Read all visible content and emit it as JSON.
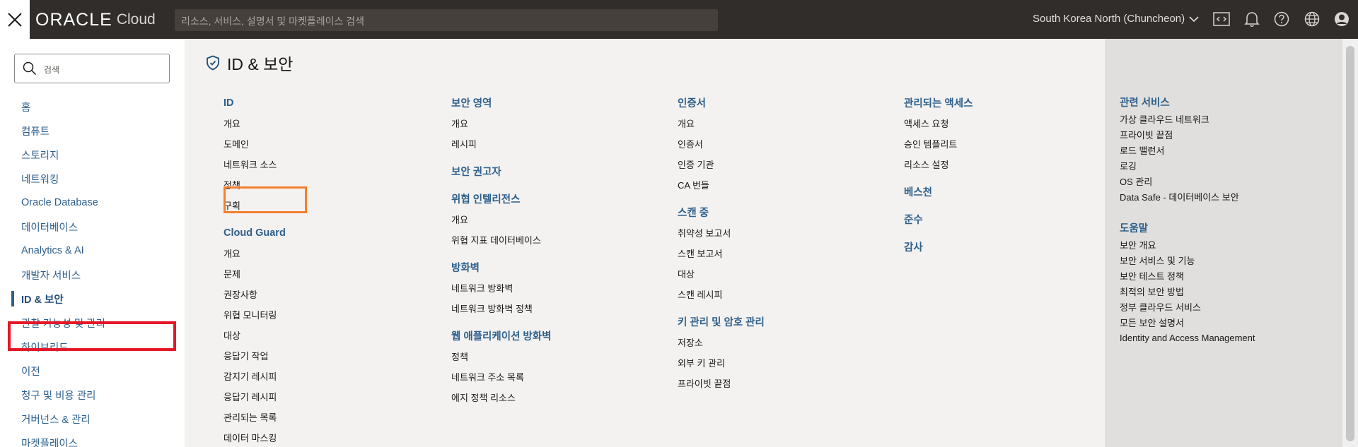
{
  "topbar": {
    "logo_oracle": "ORACLE",
    "logo_cloud": "Cloud",
    "search_placeholder": "리소스, 서비스, 설명서 및 마켓플레이스 검색",
    "region": "South Korea North (Chuncheon)",
    "icons": [
      "close-icon",
      "code-editor-icon",
      "bell-icon",
      "help-icon",
      "globe-icon",
      "profile-icon"
    ]
  },
  "sidebar": {
    "search_placeholder": "검색",
    "items": [
      {
        "label": "홈"
      },
      {
        "label": "컴퓨트"
      },
      {
        "label": "스토리지"
      },
      {
        "label": "네트워킹"
      },
      {
        "label": "Oracle Database"
      },
      {
        "label": "데이터베이스"
      },
      {
        "label": "Analytics & AI"
      },
      {
        "label": "개발자 서비스"
      },
      {
        "label": "ID & 보안",
        "active": true
      },
      {
        "label": "관찰 가능성 및 관리"
      },
      {
        "label": "하이브리드"
      },
      {
        "label": "이전"
      },
      {
        "label": "청구 및 비용 관리"
      },
      {
        "label": "거버넌스 & 관리"
      },
      {
        "label": "마켓플레이스"
      }
    ]
  },
  "main": {
    "title": "ID & 보안",
    "columns": [
      {
        "sections": [
          {
            "head": "ID",
            "links": [
              "개요",
              "도메인",
              "네트워크 소스",
              "정책",
              "구획"
            ]
          },
          {
            "head": "Cloud Guard",
            "links": [
              "개요",
              "문제",
              "권장사항",
              "위협 모니터링",
              "대상",
              "응답기 작업",
              "감지기 레시피",
              "응답기 레시피",
              "관리되는 목록",
              "데이터 마스킹"
            ]
          }
        ]
      },
      {
        "sections": [
          {
            "head": "보안 영역",
            "links": [
              "개요",
              "레시피"
            ]
          },
          {
            "head": "보안 권고자",
            "links": []
          },
          {
            "head": "위협 인텔리전스",
            "links": [
              "개요",
              "위협 지표 데이터베이스"
            ]
          },
          {
            "head": "방화벽",
            "links": [
              "네트워크 방화벽",
              "네트워크 방화벽 정책"
            ]
          },
          {
            "head": "웹 애플리케이션 방화벽",
            "links": [
              "정책",
              "네트워크 주소 목록",
              "에지 정책 리소스"
            ]
          }
        ]
      },
      {
        "sections": [
          {
            "head": "인증서",
            "links": [
              "개요",
              "인증서",
              "인증 기관",
              "CA 번들"
            ]
          },
          {
            "head": "스캔 중",
            "links": [
              "취약성 보고서",
              "스캔 보고서",
              "대상",
              "스캔 레시피"
            ]
          },
          {
            "head": "키 관리 및 암호 관리",
            "links": [
              "저장소",
              "외부 키 관리",
              "프라이빗 끝점"
            ]
          }
        ]
      },
      {
        "sections": [
          {
            "head": "관리되는 액세스",
            "links": [
              "액세스 요청",
              "승인 템플리트",
              "리소스 설정"
            ]
          },
          {
            "head": "베스천",
            "links": []
          },
          {
            "head": "준수",
            "links": []
          },
          {
            "head": "감사",
            "links": []
          }
        ]
      }
    ]
  },
  "right_panel": {
    "related_head": "관련 서비스",
    "related": [
      "가상 클라우드 네트워크",
      "프라이빗 끝점",
      "로드 밸런서",
      "로깅",
      "OS 관리",
      "Data Safe - 데이터베이스 보안"
    ],
    "help_head": "도움말",
    "help": [
      "보안 개요",
      "보안 서비스 및 기능",
      "보안 테스트 정책",
      "최적의 보안 방법",
      "정부 클라우드 서비스",
      "모든 보안 설명서",
      "Identity and Access Management"
    ]
  },
  "colors": {
    "topbar": "#312d2a",
    "link_blue": "#2d5f8b",
    "highlight_red": "#e4182a",
    "highlight_orange": "#f47f2e"
  }
}
